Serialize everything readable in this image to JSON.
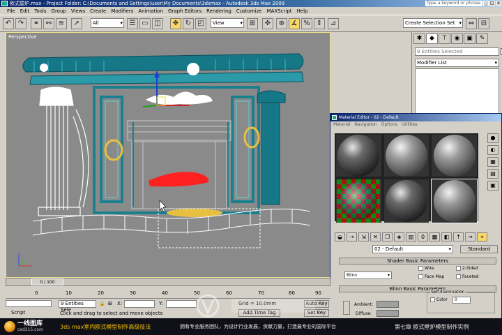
{
  "window": {
    "title": "欧式壁炉.max    - Project Folder: C:\\Documents and Settings\\user\\My Documents\\3dsmax    - Autodesk 3ds Max  2009",
    "search_placeholder": "Type a keyword or phrase",
    "controls": [
      "_",
      "□",
      "×"
    ]
  },
  "menu": [
    "File",
    "Edit",
    "Tools",
    "Group",
    "Views",
    "Create",
    "Modifiers",
    "Animation",
    "Graph Editors",
    "Rendering",
    "Customize",
    "MAXScript",
    "Help"
  ],
  "toolbar": {
    "selection_filter": "All",
    "ref_coord": "View",
    "named_selection": "Create Selection Set"
  },
  "viewport": {
    "label": "Perspective",
    "axis_labels": {
      "x": "x",
      "y": "y",
      "z": "z"
    }
  },
  "command_panel": {
    "selection": "9 Entities Selected",
    "modifier_list": "Modifier List"
  },
  "material_editor": {
    "title": "Material Editor - 02 - Default",
    "menu": [
      "Material",
      "Navigation",
      "Options",
      "Utilities"
    ],
    "material_name": "02 - Default",
    "material_type": "Standard",
    "shader_rollout": "Shader Basic Parameters",
    "shader": "Blinn",
    "checks": {
      "wire": "Wire",
      "two_sided": "2-Sided",
      "face_map": "Face Map",
      "faceted": "Faceted"
    },
    "blinn_rollout": "Blinn Basic Parameters",
    "self_illum": "Self-Illumination",
    "color_label": "Color",
    "color_value": "0",
    "ambient": "Ambient:",
    "diffuse": "Diffuse:"
  },
  "timeline": {
    "frame": "0 / 100",
    "ticks": [
      "0",
      "10",
      "20",
      "30",
      "40",
      "50",
      "60",
      "70",
      "80",
      "90"
    ]
  },
  "status": {
    "script_label": "Script",
    "selection": "9 Entities Sele",
    "x_label": "X:",
    "y_label": "Y:",
    "grid": "Grid = 10.0mm",
    "prompt": "Click and drag to select and move objects",
    "add_time_tag": "Add Time Tag",
    "auto_key": "Auto Key",
    "set_key": "Set Key"
  },
  "branding": {
    "logo_main": "一线图库",
    "logo_sub": "cad315.com",
    "course": "3ds max室内欧式模型制作高级技法",
    "slogan": "拥有专业服务团队，为设计行业发展，贡献力量，打造最专业的国际平台",
    "chapter": "第七章 欧式壁炉模型制作实例"
  },
  "colors": {
    "accent_yellow": "#f7d66a",
    "model_teal": "#1a7f8f",
    "title_blue": "#0a246a",
    "band_gold": "#f2c200"
  }
}
